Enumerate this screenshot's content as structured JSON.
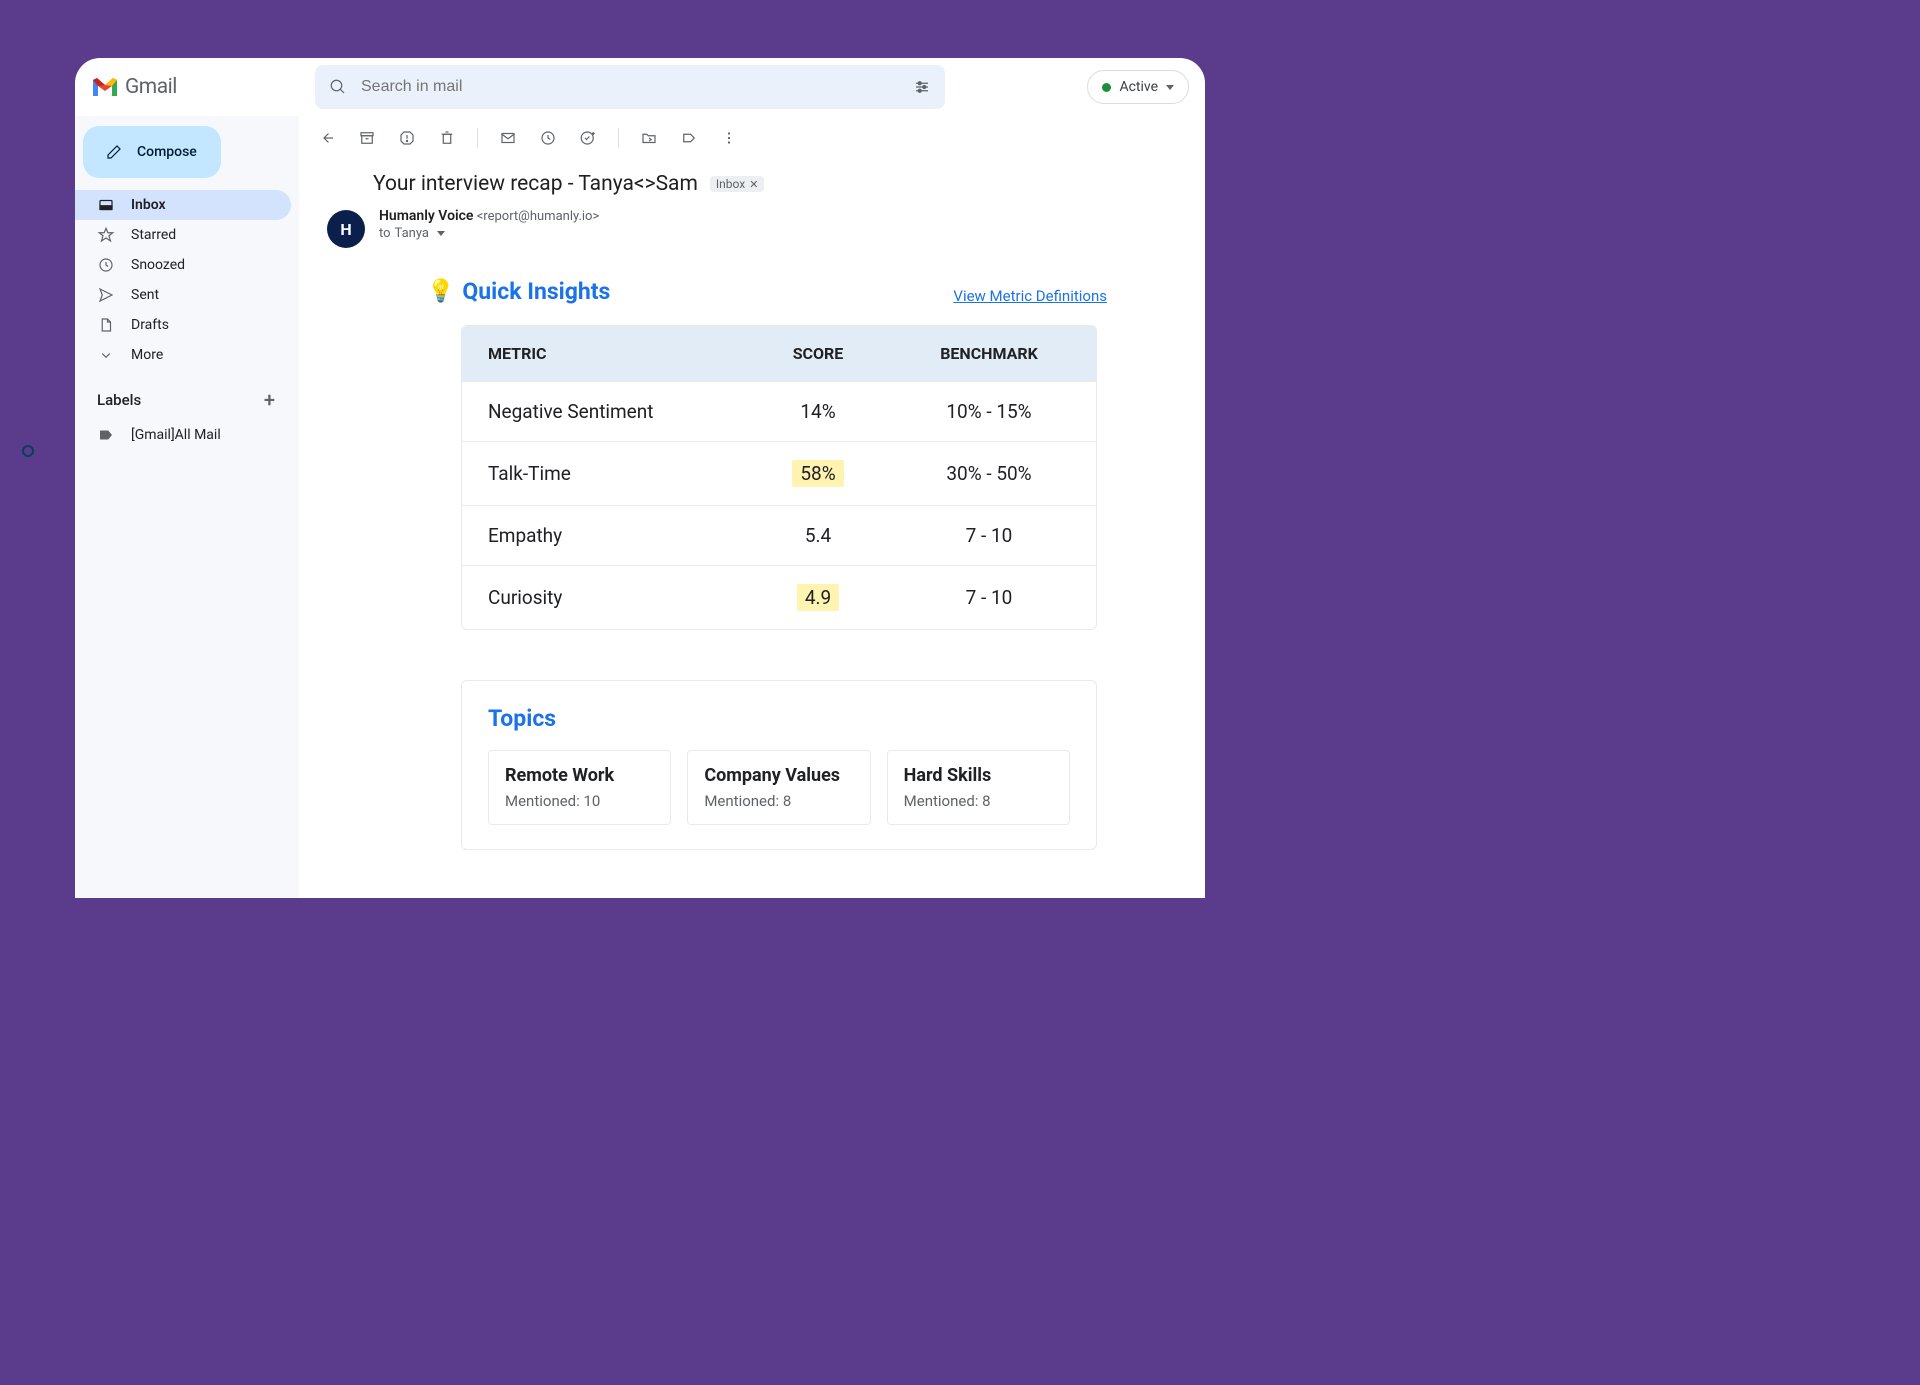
{
  "app": {
    "name": "Gmail"
  },
  "search": {
    "placeholder": "Search in mail"
  },
  "status": {
    "label": "Active"
  },
  "compose": {
    "label": "Compose"
  },
  "sidebar": {
    "items": [
      {
        "label": "Inbox"
      },
      {
        "label": "Starred"
      },
      {
        "label": "Snoozed"
      },
      {
        "label": "Sent"
      },
      {
        "label": "Drafts"
      },
      {
        "label": "More"
      }
    ],
    "labels_header": "Labels",
    "labels": [
      {
        "label": "[Gmail]All Mail"
      }
    ]
  },
  "email": {
    "subject": "Your interview recap - Tanya<>Sam",
    "label_chip": "Inbox",
    "sender_name": "Humanly Voice",
    "sender_email": "<report@humanly.io>",
    "to_prefix": "to",
    "to_name": "Tanya"
  },
  "insights": {
    "title": "Quick Insights",
    "link": "View Metric Definitions",
    "headers": {
      "metric": "METRIC",
      "score": "SCORE",
      "benchmark": "BENCHMARK"
    },
    "rows": [
      {
        "metric": "Negative Sentiment",
        "score": "14%",
        "benchmark": "10% - 15%",
        "highlight": false
      },
      {
        "metric": "Talk-Time",
        "score": "58%",
        "benchmark": "30% - 50%",
        "highlight": true
      },
      {
        "metric": "Empathy",
        "score": "5.4",
        "benchmark": "7 - 10",
        "highlight": false
      },
      {
        "metric": "Curiosity",
        "score": "4.9",
        "benchmark": "7 - 10",
        "highlight": true
      }
    ]
  },
  "topics": {
    "title": "Topics",
    "cards": [
      {
        "name": "Remote Work",
        "mentioned": "Mentioned: 10"
      },
      {
        "name": "Company Values",
        "mentioned": "Mentioned: 8"
      },
      {
        "name": "Hard Skills",
        "mentioned": "Mentioned: 8"
      }
    ]
  },
  "chart_data": {
    "type": "table",
    "title": "Quick Insights",
    "columns": [
      "METRIC",
      "SCORE",
      "BENCHMARK"
    ],
    "rows": [
      [
        "Negative Sentiment",
        "14%",
        "10% - 15%"
      ],
      [
        "Talk-Time",
        "58%",
        "30% - 50%"
      ],
      [
        "Empathy",
        "5.4",
        "7 - 10"
      ],
      [
        "Curiosity",
        "4.9",
        "7 - 10"
      ]
    ],
    "highlighted_rows": [
      1,
      3
    ]
  }
}
